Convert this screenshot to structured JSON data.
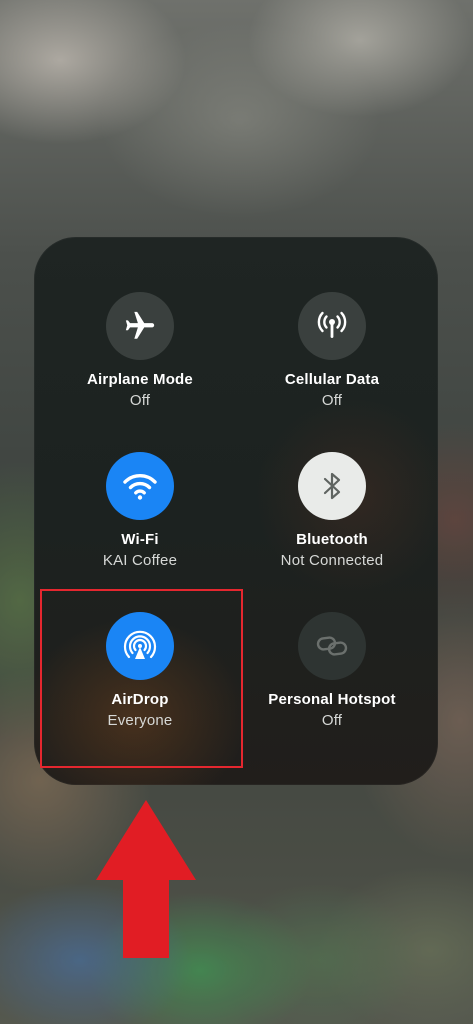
{
  "tiles": [
    {
      "label": "Airplane Mode",
      "status": "Off",
      "icon": "airplane-icon",
      "color": "#3a403e"
    },
    {
      "label": "Cellular Data",
      "status": "Off",
      "icon": "cellular-antenna-icon",
      "color": "#3a403e"
    },
    {
      "label": "Wi-Fi",
      "status": "KAI Coffee",
      "icon": "wifi-icon",
      "color": "#1a85f5"
    },
    {
      "label": "Bluetooth",
      "status": "Not Connected",
      "icon": "bluetooth-icon",
      "color": "#e9ebe9"
    },
    {
      "label": "AirDrop",
      "status": "Everyone",
      "icon": "airdrop-icon",
      "color": "#1a85f5"
    },
    {
      "label": "Personal Hotspot",
      "status": "Off",
      "icon": "hotspot-link-icon",
      "color": "#2e3432"
    }
  ],
  "annotation": {
    "highlight_color": "#e5272f",
    "arrow_color": "#e11d24",
    "highlighted_tile": "AirDrop"
  }
}
